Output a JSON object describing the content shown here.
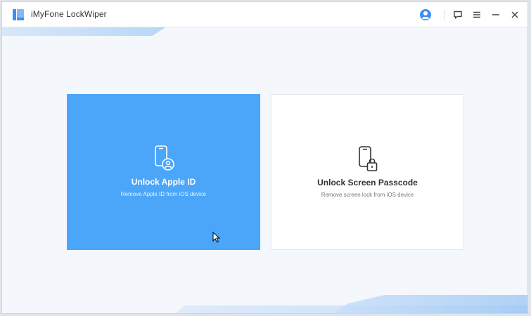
{
  "app": {
    "title": "iMyFone LockWiper",
    "logo_icon": "lockwiper-logo-icon"
  },
  "titlebar": {
    "icons": [
      "user-account-icon",
      "feedback-icon",
      "menu-icon",
      "minimize-icon",
      "close-icon"
    ]
  },
  "cards": [
    {
      "title": "Unlock Apple ID",
      "subtitle": "Remove Apple ID from iOS device",
      "icon": "phone-user-icon",
      "selected": true
    },
    {
      "title": "Unlock Screen Passcode",
      "subtitle": "Remove screen lock from iOS device",
      "icon": "phone-lock-icon",
      "selected": false
    }
  ],
  "colors": {
    "accent": "#4ba6fa",
    "window_bg": "#f4f7fb",
    "stripe": "#b8d6f7",
    "account_icon": "#3d8ef5"
  }
}
